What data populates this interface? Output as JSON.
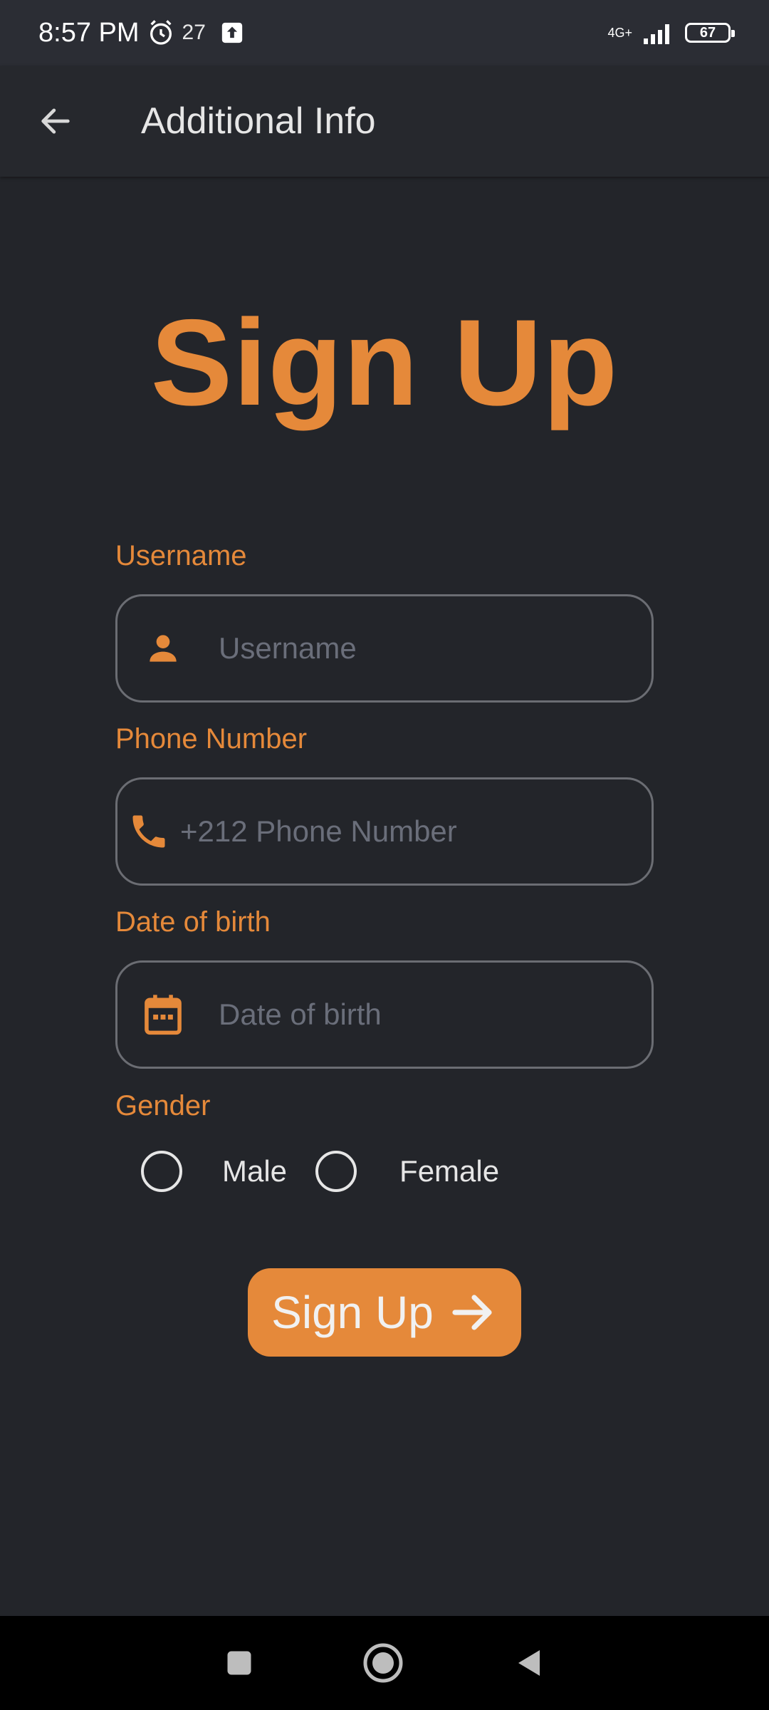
{
  "status_bar": {
    "time": "8:57 PM",
    "temperature": "27",
    "network": "4G+",
    "battery": "67"
  },
  "app_bar": {
    "title": "Additional Info"
  },
  "page": {
    "heading": "Sign Up"
  },
  "form": {
    "username": {
      "label": "Username",
      "placeholder": "Username",
      "icon": "person-icon"
    },
    "phone": {
      "label": "Phone Number",
      "prefix": "+212",
      "placeholder": "Phone Number",
      "icon": "phone-icon"
    },
    "dob": {
      "label": "Date of birth",
      "placeholder": "Date of birth",
      "icon": "calendar-icon"
    },
    "gender": {
      "label": "Gender",
      "options": [
        "Male",
        "Female"
      ]
    }
  },
  "submit": {
    "label": "Sign Up",
    "icon": "arrow-right-icon"
  },
  "colors": {
    "accent": "#e5893a",
    "background": "#23252a",
    "field_border": "#6b6d73"
  }
}
